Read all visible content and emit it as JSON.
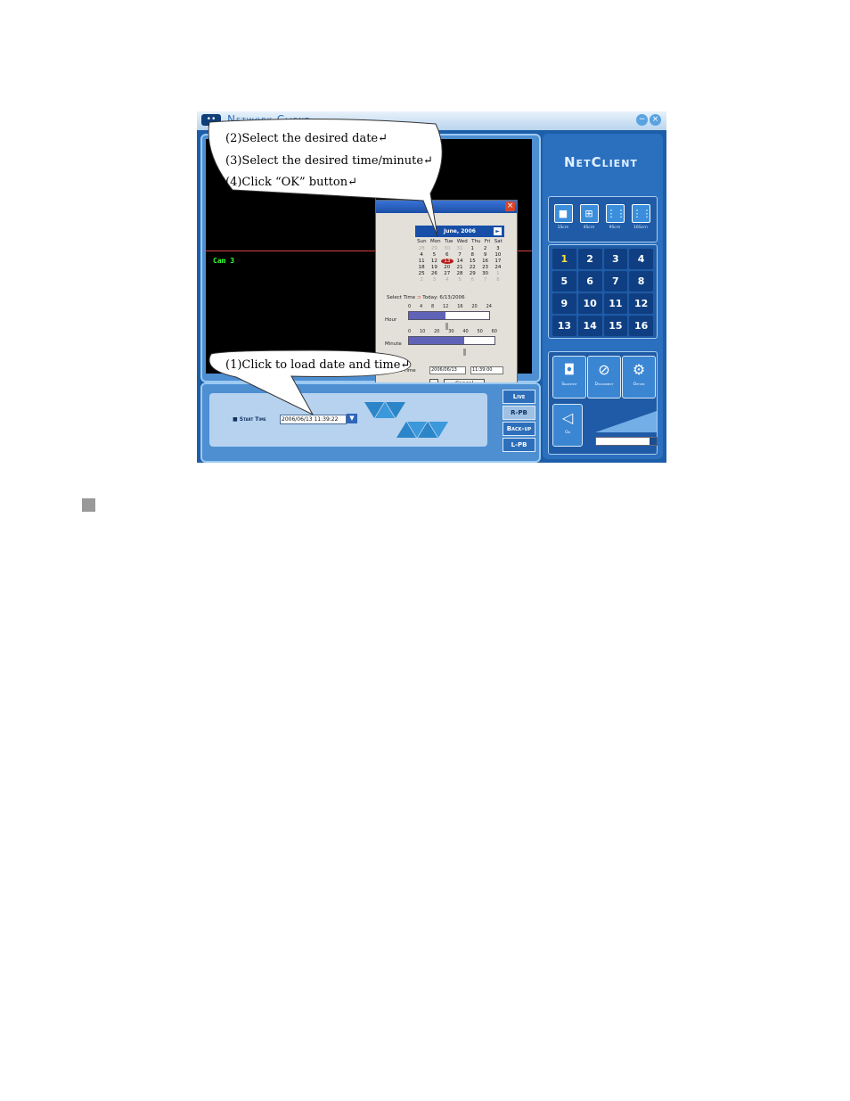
{
  "window": {
    "title": "Network Client",
    "logo": "••",
    "minimize": "−",
    "close": "×"
  },
  "video": {
    "cam_label": "Cam  3"
  },
  "calendar_dialog": {
    "close": "×",
    "month": "June, 2006",
    "next": "►",
    "weekdays": [
      "Sun",
      "Mon",
      "Tue",
      "Wed",
      "Thu",
      "Fri",
      "Sat"
    ],
    "days": [
      "28",
      "29",
      "30",
      "31",
      "1",
      "2",
      "3",
      "4",
      "5",
      "6",
      "7",
      "8",
      "9",
      "10",
      "11",
      "12",
      "13",
      "14",
      "15",
      "16",
      "17",
      "18",
      "19",
      "20",
      "21",
      "22",
      "23",
      "24",
      "25",
      "26",
      "27",
      "28",
      "29",
      "30",
      "1",
      "2",
      "3",
      "4",
      "5",
      "6",
      "7",
      "8"
    ],
    "selected_day": "13",
    "select_time_label": "Select Time",
    "today_label": "Today: 6/13/2006",
    "hour_label": "Hour",
    "hour_ticks": [
      "0",
      "4",
      "8",
      "12",
      "16",
      "20",
      "24"
    ],
    "hour_value": 11,
    "minute_label": "Minute",
    "minute_ticks": [
      "0",
      "10",
      "20",
      "30",
      "40",
      "50",
      "60"
    ],
    "minute_value": 39,
    "start_time_label": "Start Time",
    "start_date": "2006/06/13",
    "start_clock": "11:39:00",
    "cancel_label": "Cancel"
  },
  "bottom": {
    "start_time_label": "■ Start Time",
    "start_time_value": "2006/06/13 11:39:22",
    "dropdown_icon": "▼",
    "modes": [
      "Live",
      "R-PB",
      "Back-up",
      "L-PB"
    ],
    "active_mode": "R-PB"
  },
  "right": {
    "brand": "NetClient",
    "divisions": [
      {
        "label": "1Scrn",
        "icon": "■"
      },
      {
        "label": "4Scrn",
        "icon": "⊞"
      },
      {
        "label": "9Scrn",
        "icon": "⋮⋮"
      },
      {
        "label": "16Scrn",
        "icon": "⋮⋮"
      }
    ],
    "cameras": [
      "1",
      "2",
      "3",
      "4",
      "5",
      "6",
      "7",
      "8",
      "9",
      "10",
      "11",
      "12",
      "13",
      "14",
      "15",
      "16"
    ],
    "active_camera": "1",
    "controls": {
      "snapshot": "Snapshot",
      "disconnect": "Disconnect",
      "option": "Option",
      "audio": "On"
    }
  },
  "callouts": {
    "top_lines": [
      "(2)Select the desired date↵",
      "(3)Select the desired time/minute↵",
      "(4)Click “OK” button↵"
    ],
    "bottom_line": "(1)Click to load date and time↵"
  }
}
